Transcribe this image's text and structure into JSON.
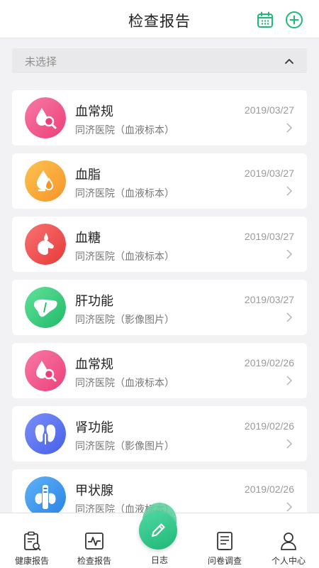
{
  "header": {
    "title": "检查报告",
    "calendar_icon": "calendar-icon",
    "add_icon": "plus-circle-icon",
    "accent": "#20b876"
  },
  "filter": {
    "value": "未选择",
    "icon": "chevron-up-icon"
  },
  "reports": [
    {
      "name": "血常规",
      "source": "同济医院（血液标本）",
      "date": "2019/03/27",
      "icon": "blood-drop-magnifier-icon",
      "color": "#f0558b"
    },
    {
      "name": "血脂",
      "source": "同济医院（血液标本）",
      "date": "2019/03/27",
      "icon": "blood-drop-lipid-icon",
      "color": "#f7a53a"
    },
    {
      "name": "血糖",
      "source": "同济医院（血液标本）",
      "date": "2019/03/27",
      "icon": "glucose-test-icon",
      "color": "#ee4f4f"
    },
    {
      "name": "肝功能",
      "source": "同济医院（影像图片）",
      "date": "2019/03/27",
      "icon": "liver-icon",
      "color": "#36c97e"
    },
    {
      "name": "血常规",
      "source": "同济医院（血液标本）",
      "date": "2019/02/26",
      "icon": "blood-drop-magnifier-icon",
      "color": "#f0558b"
    },
    {
      "name": "肾功能",
      "source": "同济医院（影像图片）",
      "date": "2019/02/26",
      "icon": "kidney-icon",
      "color": "#5a73ef"
    },
    {
      "name": "甲状腺",
      "source": "同济医院（血液标本）",
      "date": "2019/02/26",
      "icon": "thyroid-icon",
      "color": "#3a8fe8"
    }
  ],
  "nav": {
    "items": [
      {
        "label": "健康报告",
        "icon": "clipboard-report-icon"
      },
      {
        "label": "检查报告",
        "icon": "pulse-chart-icon"
      },
      {
        "label": "日志",
        "icon": "pencil-icon"
      },
      {
        "label": "问卷调查",
        "icon": "questionnaire-icon"
      },
      {
        "label": "个人中心",
        "icon": "person-icon"
      }
    ]
  }
}
